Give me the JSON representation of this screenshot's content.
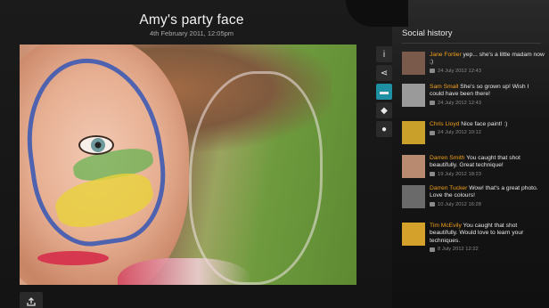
{
  "photo": {
    "title": "Amy's party face",
    "date": "4th February 2011, 12:05pm"
  },
  "tools": [
    {
      "icon": "info-icon",
      "glyph": "i",
      "active": false
    },
    {
      "icon": "share-icon",
      "glyph": "⋖",
      "active": false
    },
    {
      "icon": "comment-icon",
      "glyph": "▬",
      "active": true
    },
    {
      "icon": "tag-icon",
      "glyph": "◆",
      "active": false
    },
    {
      "icon": "location-pin-icon",
      "glyph": "●",
      "active": false
    }
  ],
  "social": {
    "title": "Social history",
    "comments": [
      {
        "name": "Jane Fortier",
        "text": "yep... she's a little madam now ;)",
        "time": "24 July 2012  12:43",
        "avatar_color": "#7a5a4a"
      },
      {
        "name": "Sam Small",
        "text": "She's so grown up! Wish I could have been there!",
        "time": "24 July 2012  12:43",
        "avatar_color": "#9a9a9a"
      },
      {
        "name": "Chris Lloyd",
        "text": "Nice face paint! :)",
        "time": "24 July 2012  10:12",
        "avatar_color": "#c8a02a"
      },
      {
        "name": "Darren Smith",
        "text": "You caught that shot beautifully. Great technique!",
        "time": "19 July 2012  18:23",
        "avatar_color": "#b88a70"
      },
      {
        "name": "Darren Tucker",
        "text": "Wow! that's a great photo. Love the colours!",
        "time": "10 July 2012  16:28",
        "avatar_color": "#6a6a6a"
      },
      {
        "name": "Tim McEvily",
        "text": "You caught that shot beautifully. Would love to learn your techniques.",
        "time": "8 July 2012  12:22",
        "avatar_color": "#d4a12a"
      }
    ]
  }
}
